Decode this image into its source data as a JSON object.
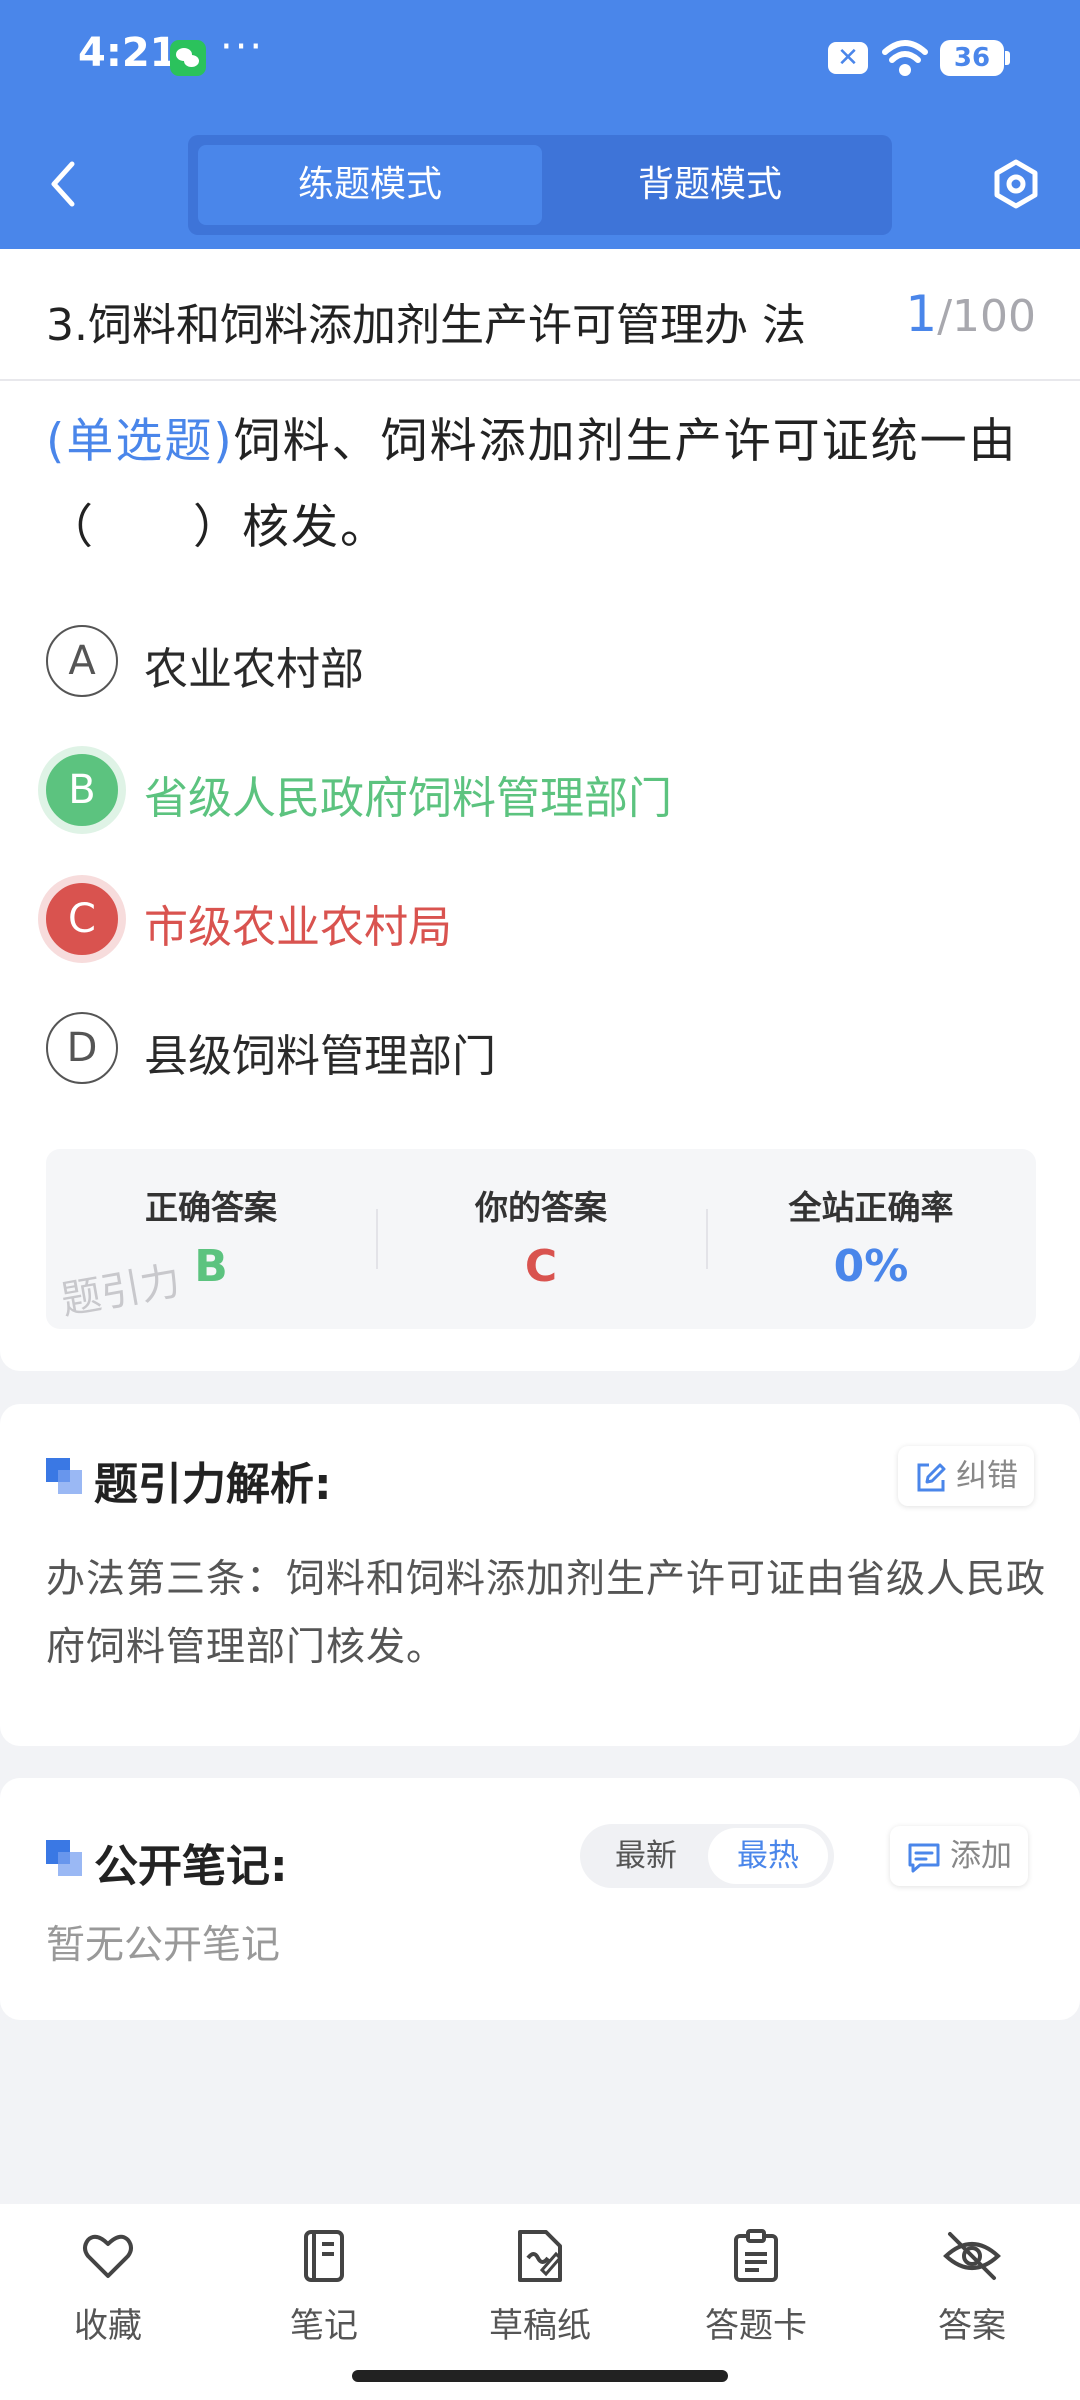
{
  "status_bar": {
    "time": "4:21",
    "dots": "···",
    "battery": "36",
    "icons": [
      "wechat-icon",
      "close-icon",
      "wifi-icon",
      "battery-icon"
    ]
  },
  "header": {
    "tabs": [
      {
        "label": "练题模式",
        "active": true
      },
      {
        "label": "背题模式",
        "active": false
      }
    ],
    "icons": [
      "back-icon",
      "settings-icon"
    ]
  },
  "question": {
    "chapter_title": "3.饲料和饲料添加剂生产许可管理办 法",
    "progress_current": "1",
    "progress_total": "/100",
    "type_label": "(单选题)",
    "stem": "饲料、饲料添加剂生产许可证统一由（　　）核发。",
    "options": [
      {
        "letter": "A",
        "text": "农业农村部",
        "state": "normal"
      },
      {
        "letter": "B",
        "text": "省级人民政府饲料管理部门",
        "state": "correct"
      },
      {
        "letter": "C",
        "text": "市级农业农村局",
        "state": "wrong"
      },
      {
        "letter": "D",
        "text": "县级饲料管理部门",
        "state": "normal"
      }
    ]
  },
  "answer_summary": {
    "correct_label": "正确答案",
    "correct_value": "B",
    "yours_label": "你的答案",
    "yours_value": "C",
    "rate_label": "全站正确率",
    "rate_value": "0%",
    "watermark": "题引力",
    "colors": {
      "correct": "#5cc37f",
      "wrong": "#d9534f",
      "accent": "#4a86ea"
    }
  },
  "analysis": {
    "title": "题引力解析:",
    "report_label": "纠错",
    "text": "办法第三条：饲料和饲料添加剂生产许可证由省级人民政府饲料管理部门核发。"
  },
  "notes": {
    "title": "公开笔记:",
    "sort_options": [
      "最新",
      "最热"
    ],
    "sort_selected": "最热",
    "add_label": "添加",
    "empty_text": "暂无公开笔记"
  },
  "bottom_bar": {
    "items": [
      {
        "label": "收藏",
        "icon": "heart-icon"
      },
      {
        "label": "笔记",
        "icon": "notebook-icon"
      },
      {
        "label": "草稿纸",
        "icon": "draft-icon"
      },
      {
        "label": "答题卡",
        "icon": "answer-sheet-icon"
      },
      {
        "label": "答案",
        "icon": "eye-off-icon"
      }
    ]
  }
}
